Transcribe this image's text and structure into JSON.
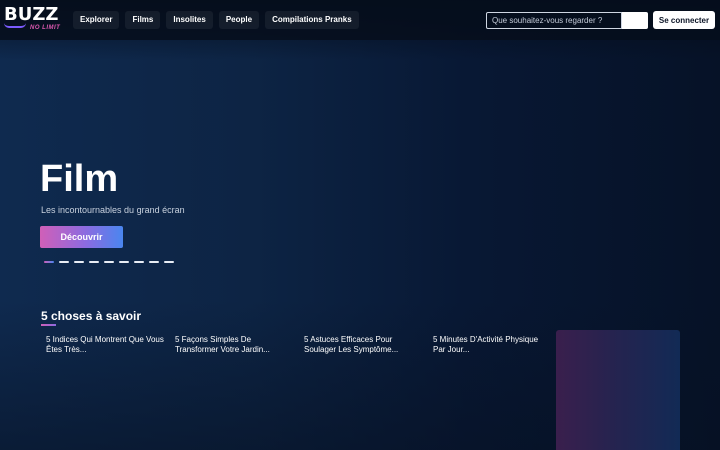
{
  "brand": {
    "name": "BUZZ",
    "tagline": "NO LIMIT"
  },
  "nav": [
    {
      "label": "Explorer"
    },
    {
      "label": "Films"
    },
    {
      "label": "Insolites"
    },
    {
      "label": "People"
    },
    {
      "label": "Compilations Pranks"
    }
  ],
  "search": {
    "placeholder": "Que souhaitez-vous regarder ?",
    "value": ""
  },
  "login_label": "Se connecter",
  "hero": {
    "title": "Film",
    "subtitle": "Les incontournables du grand écran",
    "cta_label": "Découvrir",
    "slide_count": 9,
    "active_slide": 1
  },
  "section": {
    "title": "5 choses à savoir",
    "cards": [
      {
        "title": "5 Indices Qui Montrent Que Vous Êtes Très..."
      },
      {
        "title": "5 Façons Simples De Transformer Votre Jardin..."
      },
      {
        "title": "5 Astuces Efficaces Pour Soulager Les Symptôme..."
      },
      {
        "title": "5 Minutes D'Activité Physique Par Jour..."
      }
    ]
  },
  "colors": {
    "background": "#0a1a33",
    "accent_pink": "#d05fb8",
    "accent_blue": "#4a86ef",
    "button_light": "#ffffff"
  }
}
